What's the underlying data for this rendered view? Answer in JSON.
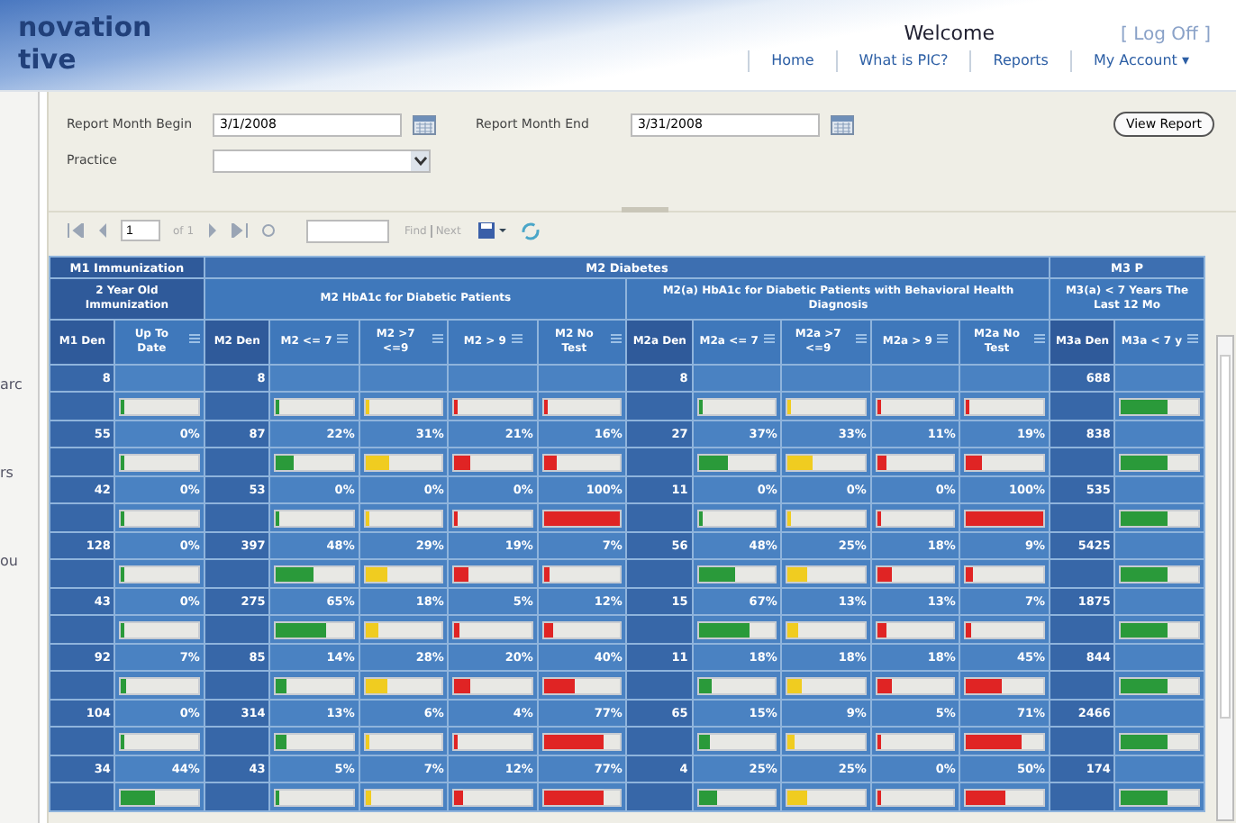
{
  "header": {
    "logo_lines": [
      "novation",
      "tive"
    ],
    "welcome": "Welcome",
    "logoff": "[ Log Off ]",
    "nav": [
      {
        "label": "Home"
      },
      {
        "label": "What is PIC?"
      },
      {
        "label": "Reports"
      },
      {
        "label": "My Account",
        "caret": "▾"
      }
    ]
  },
  "sidebar_fragments": [
    "arc",
    "rs",
    "ou"
  ],
  "params": {
    "begin_label": "Report Month Begin",
    "begin_value": "3/1/2008",
    "end_label": "Report Month End",
    "end_value": "3/31/2008",
    "practice_label": "Practice",
    "button": "View Report"
  },
  "toolbar": {
    "page": "1",
    "of": "of 1",
    "find": "Find",
    "next": "Next"
  },
  "table": {
    "groups": [
      {
        "label": "M1 Immunization",
        "subgroups": [
          {
            "label": "2 Year Old Immunization",
            "columns": [
              {
                "label": "M1 Den",
                "kind": "count"
              },
              {
                "label": "Up To Date",
                "kind": "rate",
                "color": "#2a9a3a"
              }
            ]
          }
        ]
      },
      {
        "label": "M2 Diabetes",
        "subgroups": [
          {
            "label": "M2 HbA1c for Diabetic Patients",
            "columns": [
              {
                "label": "M2 Den",
                "kind": "count"
              },
              {
                "label": "M2 <= 7",
                "kind": "rate",
                "color": "#2a9a3a"
              },
              {
                "label": "M2 >7 <=9",
                "kind": "rate",
                "color": "#f0cc20"
              },
              {
                "label": "M2 > 9",
                "kind": "rate",
                "color": "#e02424"
              },
              {
                "label": "M2 No Test",
                "kind": "rate",
                "color": "#e02424"
              }
            ]
          },
          {
            "label": "M2(a) HbA1c for Diabetic Patients with Behavioral Health Diagnosis",
            "columns": [
              {
                "label": "M2a Den",
                "kind": "count"
              },
              {
                "label": "M2a <= 7",
                "kind": "rate",
                "color": "#2a9a3a"
              },
              {
                "label": "M2a >7 <=9",
                "kind": "rate",
                "color": "#f0cc20"
              },
              {
                "label": "M2a > 9",
                "kind": "rate",
                "color": "#e02424"
              },
              {
                "label": "M2a No Test",
                "kind": "rate",
                "color": "#e02424"
              }
            ]
          }
        ]
      },
      {
        "label": "M3 P",
        "subgroups": [
          {
            "label": "M3(a) < 7 Years The Last 12 Mo",
            "columns": [
              {
                "label": "M3a Den",
                "kind": "count"
              },
              {
                "label": "M3a < 7 y",
                "kind": "rate",
                "color": "#2a9a3a"
              }
            ]
          }
        ]
      }
    ],
    "rows": [
      {
        "cells": [
          {
            "value": "8"
          },
          {
            "level": 0
          },
          {
            "value": "8"
          },
          {
            "level": 0
          },
          {
            "level": 0
          },
          {
            "level": 0
          },
          {
            "level": 0
          },
          {
            "value": "8"
          },
          {
            "level": 0
          },
          {
            "level": 0
          },
          {
            "level": 0
          },
          {
            "level": 0
          },
          {
            "value": "688"
          },
          {
            "level": 0.6
          }
        ]
      },
      {
        "cells": [
          {
            "value": "55"
          },
          {
            "value": "0%",
            "level": 0
          },
          {
            "value": "87"
          },
          {
            "value": "22%",
            "level": 0.22
          },
          {
            "value": "31%",
            "level": 0.31
          },
          {
            "value": "21%",
            "level": 0.21
          },
          {
            "value": "16%",
            "level": 0.16
          },
          {
            "value": "27"
          },
          {
            "value": "37%",
            "level": 0.37
          },
          {
            "value": "33%",
            "level": 0.33
          },
          {
            "value": "11%",
            "level": 0.11
          },
          {
            "value": "19%",
            "level": 0.19
          },
          {
            "value": "838"
          },
          {
            "level": 0.6
          }
        ]
      },
      {
        "cells": [
          {
            "value": "42"
          },
          {
            "value": "0%",
            "level": 0
          },
          {
            "value": "53"
          },
          {
            "value": "0%",
            "level": 0
          },
          {
            "value": "0%",
            "level": 0
          },
          {
            "value": "0%",
            "level": 0
          },
          {
            "value": "100%",
            "level": 1
          },
          {
            "value": "11"
          },
          {
            "value": "0%",
            "level": 0
          },
          {
            "value": "0%",
            "level": 0
          },
          {
            "value": "0%",
            "level": 0
          },
          {
            "value": "100%",
            "level": 1
          },
          {
            "value": "535"
          },
          {
            "level": 0.6
          }
        ]
      },
      {
        "cells": [
          {
            "value": "128"
          },
          {
            "value": "0%",
            "level": 0
          },
          {
            "value": "397"
          },
          {
            "value": "48%",
            "level": 0.48
          },
          {
            "value": "29%",
            "level": 0.29
          },
          {
            "value": "19%",
            "level": 0.19
          },
          {
            "value": "7%",
            "level": 0.07
          },
          {
            "value": "56"
          },
          {
            "value": "48%",
            "level": 0.48
          },
          {
            "value": "25%",
            "level": 0.25
          },
          {
            "value": "18%",
            "level": 0.18
          },
          {
            "value": "9%",
            "level": 0.09
          },
          {
            "value": "5425"
          },
          {
            "level": 0.6
          }
        ]
      },
      {
        "cells": [
          {
            "value": "43"
          },
          {
            "value": "0%",
            "level": 0
          },
          {
            "value": "275"
          },
          {
            "value": "65%",
            "level": 0.65
          },
          {
            "value": "18%",
            "level": 0.18
          },
          {
            "value": "5%",
            "level": 0.05
          },
          {
            "value": "12%",
            "level": 0.12
          },
          {
            "value": "15"
          },
          {
            "value": "67%",
            "level": 0.67
          },
          {
            "value": "13%",
            "level": 0.13
          },
          {
            "value": "13%",
            "level": 0.13
          },
          {
            "value": "7%",
            "level": 0.07
          },
          {
            "value": "1875"
          },
          {
            "level": 0.6
          }
        ]
      },
      {
        "cells": [
          {
            "value": "92"
          },
          {
            "value": "7%",
            "level": 0.07
          },
          {
            "value": "85"
          },
          {
            "value": "14%",
            "level": 0.14
          },
          {
            "value": "28%",
            "level": 0.28
          },
          {
            "value": "20%",
            "level": 0.2
          },
          {
            "value": "40%",
            "level": 0.4
          },
          {
            "value": "11"
          },
          {
            "value": "18%",
            "level": 0.18
          },
          {
            "value": "18%",
            "level": 0.18
          },
          {
            "value": "18%",
            "level": 0.18
          },
          {
            "value": "45%",
            "level": 0.45
          },
          {
            "value": "844"
          },
          {
            "level": 0.6
          }
        ]
      },
      {
        "cells": [
          {
            "value": "104"
          },
          {
            "value": "0%",
            "level": 0
          },
          {
            "value": "314"
          },
          {
            "value": "13%",
            "level": 0.13
          },
          {
            "value": "6%",
            "level": 0.06
          },
          {
            "value": "4%",
            "level": 0.04
          },
          {
            "value": "77%",
            "level": 0.77
          },
          {
            "value": "65"
          },
          {
            "value": "15%",
            "level": 0.15
          },
          {
            "value": "9%",
            "level": 0.09
          },
          {
            "value": "5%",
            "level": 0.05
          },
          {
            "value": "71%",
            "level": 0.71
          },
          {
            "value": "2466"
          },
          {
            "level": 0.6
          }
        ]
      },
      {
        "cells": [
          {
            "value": "34"
          },
          {
            "value": "44%",
            "level": 0.44
          },
          {
            "value": "43"
          },
          {
            "value": "5%",
            "level": 0.05
          },
          {
            "value": "7%",
            "level": 0.07
          },
          {
            "value": "12%",
            "level": 0.12
          },
          {
            "value": "77%",
            "level": 0.77
          },
          {
            "value": "4"
          },
          {
            "value": "25%",
            "level": 0.25
          },
          {
            "value": "25%",
            "level": 0.25
          },
          {
            "value": "0%",
            "level": 0
          },
          {
            "value": "50%",
            "level": 0.5
          },
          {
            "value": "174"
          },
          {
            "level": 0.6
          }
        ]
      }
    ]
  }
}
